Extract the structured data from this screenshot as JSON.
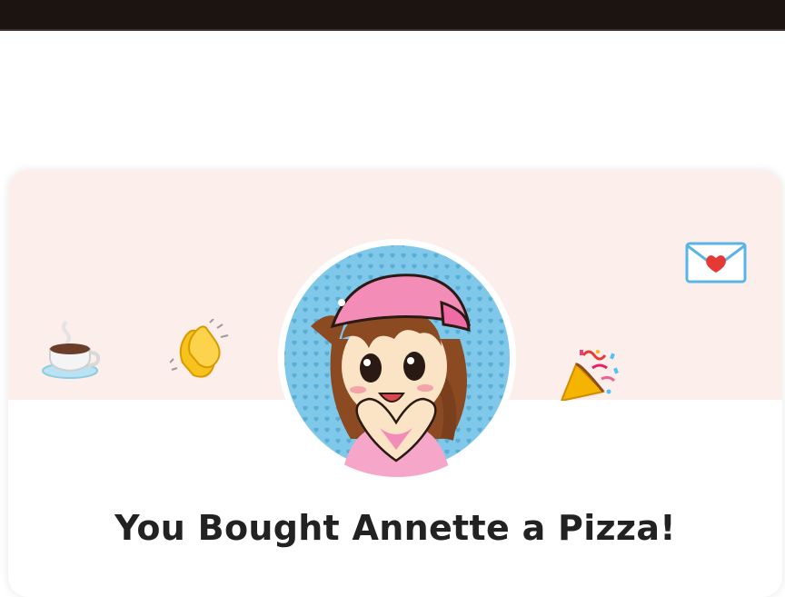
{
  "page": {
    "title": "You Bought Annette a Pizza!"
  },
  "emojis": [
    {
      "name": "hot-beverage-icon",
      "symbol": "coffee"
    },
    {
      "name": "clapping-hands-icon",
      "symbol": "clap"
    },
    {
      "name": "party-popper-icon",
      "symbol": "party"
    },
    {
      "name": "love-letter-icon",
      "symbol": "love-letter"
    }
  ],
  "avatar": {
    "description_icon": "creator-avatar"
  },
  "colors": {
    "header_bg": "#fcefeb",
    "top_bar": "#1b1410",
    "title_text": "#222222"
  }
}
